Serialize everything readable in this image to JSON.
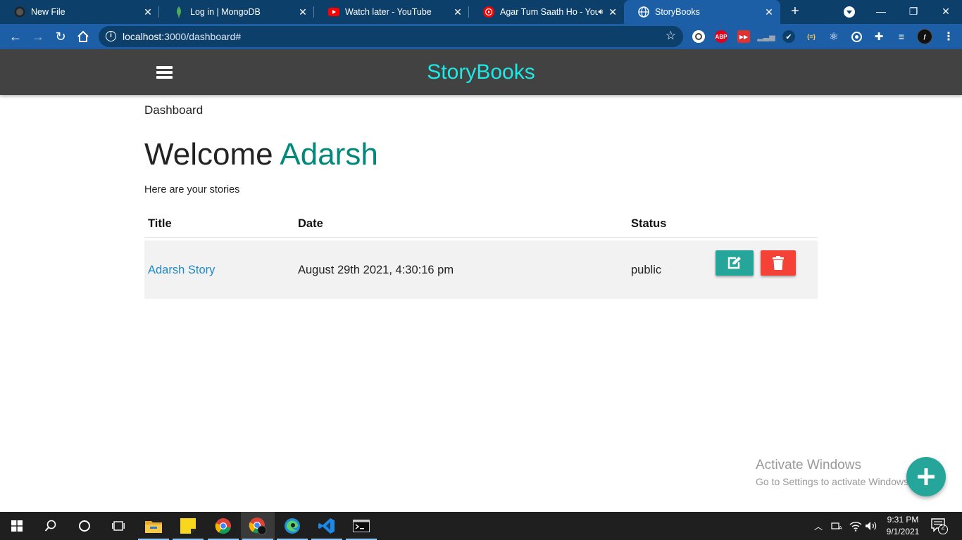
{
  "browser": {
    "tabs": [
      {
        "title": "New File",
        "icon": "github-icon"
      },
      {
        "title": "Log in | MongoDB",
        "icon": "mongodb-leaf-icon"
      },
      {
        "title": "Watch later - YouTube",
        "icon": "youtube-icon"
      },
      {
        "title": "Agar Tum Saath Ho - You",
        "icon": "youtube-music-icon"
      },
      {
        "title": "StoryBooks",
        "icon": "globe-icon"
      }
    ],
    "active_tab": 4,
    "url_host": "localhost",
    "url_rest": ":3000/dashboard#",
    "extensions": [
      {
        "name": "block-icon",
        "color": "#ffffff"
      },
      {
        "name": "adblock-plus-icon",
        "label": "ABP",
        "color": "#e2001a"
      },
      {
        "name": "forward-icon",
        "color": "#e03131"
      },
      {
        "name": "chart-icon",
        "color": "#9aa5b1"
      },
      {
        "name": "check-icon",
        "color": "#0d3f6b"
      },
      {
        "name": "json-icon",
        "color": "#ffc94d"
      },
      {
        "name": "react-icon",
        "color": "#ffffff"
      },
      {
        "name": "target-icon",
        "color": "#ffffff"
      },
      {
        "name": "puzzle-icon",
        "color": "#ffffff"
      },
      {
        "name": "reading-list-icon",
        "color": "#ffffff"
      },
      {
        "name": "profile-avatar-icon",
        "color": "#111111"
      }
    ]
  },
  "app": {
    "brand": "StoryBooks",
    "brand_color": "#1de9e6",
    "nav_color": "#424242",
    "breadcrumb": "Dashboard",
    "welcome_prefix": "Welcome",
    "user_name": "Adarsh",
    "subtitle": "Here are your stories",
    "table": {
      "headers": {
        "title": "Title",
        "date": "Date",
        "status": "Status"
      },
      "rows": [
        {
          "title": "Adarsh Story",
          "date": "August 29th 2021, 4:30:16 pm",
          "status": "public"
        }
      ]
    },
    "accent": "#26a69a",
    "danger": "#f44336"
  },
  "watermark": {
    "line1": "Activate Windows",
    "line2": "Go to Settings to activate Windows."
  },
  "taskbar": {
    "apps": [
      "start-icon",
      "search-icon",
      "cortana-icon",
      "task-view-icon",
      "file-explorer-icon",
      "sticky-notes-icon",
      "chrome-icon",
      "chrome-canary-icon",
      "edge-icon",
      "vscode-icon",
      "terminal-icon"
    ],
    "time": "9:31 PM",
    "date": "9/1/2021",
    "notifications": "2"
  }
}
